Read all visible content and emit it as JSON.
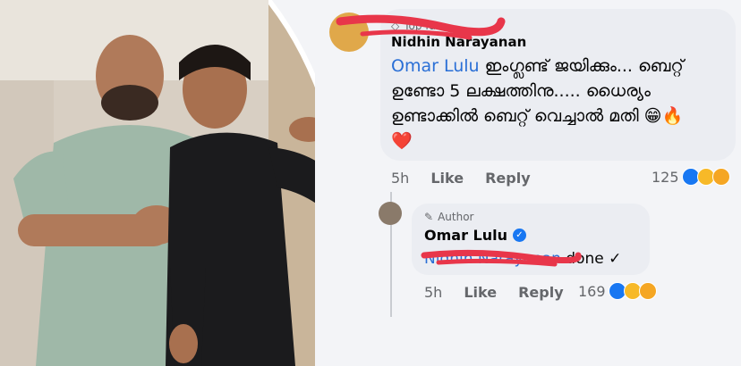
{
  "comment1": {
    "badge": "Top fan",
    "author": "Nidhin Narayanan",
    "mention": "Omar Lulu",
    "text_line1": " ഇംഗ്ലണ്ട് ജയിക്കും... ബെറ്റ്",
    "text_line2": "ഉണ്ടോ 5 ലക്ഷത്തിനു..... ധൈര്യം",
    "text_line3": "ഉണ്ടാക്കിൽ ബെറ്റ് വെച്ചാൽ മതി 😁🔥",
    "text_line4": "❤️",
    "time": "5h",
    "like": "Like",
    "reply": "Reply",
    "reaction_count": "125"
  },
  "comment2": {
    "badge": "Author",
    "author": "Omar Lulu",
    "mention": "Nidhin Narayanan",
    "text": " done ✓",
    "time": "5h",
    "like": "Like",
    "reply": "Reply",
    "reaction_count": "169"
  },
  "colors": {
    "mention": "#2a6fd6",
    "scribble": "#e8364a",
    "verified": "#1877f2"
  },
  "icons": {
    "badge1": "diamond-icon",
    "badge2": "pencil-icon",
    "verified": "verified-badge-icon",
    "reactions": [
      "like-reaction-icon",
      "wow-reaction-icon",
      "haha-reaction-icon"
    ]
  }
}
